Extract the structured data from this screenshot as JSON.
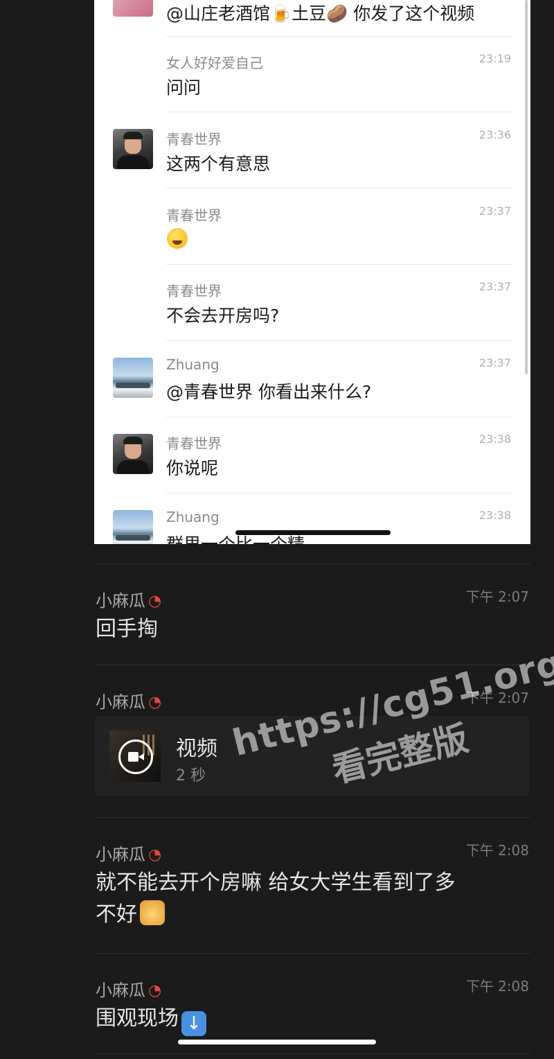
{
  "embedded_chat": {
    "messages": [
      {
        "sender": "",
        "time": "",
        "text": "@山庄老酒馆🍺土豆🥔 你发了这个视频"
      },
      {
        "sender": "女人好好爱自己",
        "time": "23:19",
        "text": "问问"
      },
      {
        "sender": "青春世界",
        "time": "23:36",
        "text": "这两个有意思"
      },
      {
        "sender": "青春世界",
        "time": "23:37",
        "text": ""
      },
      {
        "sender": "青春世界",
        "time": "23:37",
        "text": "不会去开房吗?"
      },
      {
        "sender": "Zhuang",
        "time": "23:37",
        "text": "@青春世界 你看出来什么?"
      },
      {
        "sender": "青春世界",
        "time": "23:38",
        "text": "你说呢"
      },
      {
        "sender": "Zhuang",
        "time": "23:38",
        "text": "群里一个比一个精"
      }
    ]
  },
  "chat": {
    "messages": [
      {
        "sender": "小麻瓜",
        "time": "下午 2:07",
        "text": "回手掏"
      },
      {
        "sender": "小麻瓜",
        "time": "下午 2:07",
        "video": {
          "label": "视频",
          "duration": "2 秒"
        }
      },
      {
        "sender": "小麻瓜",
        "time": "下午 2:08",
        "text_line1": "就不能去开个房嘛 给女大学生看到了多",
        "text_line2": "不好"
      },
      {
        "sender": "小麻瓜",
        "time": "下午 2:08",
        "text": "围观现场"
      }
    ]
  },
  "watermark": {
    "url": "https://cg51.org",
    "subtitle": "看完整版"
  },
  "icons": {
    "sender_emoji": "watermelon-icon",
    "crying_laughing": "laughing-crying-emoji-icon",
    "cat_emoji": "cat-face-emoji-icon",
    "down_arrow": "down-arrow-emoji-icon",
    "video": "video-camera-icon"
  },
  "colors": {
    "background": "#1b1b1b",
    "embedded_background": "#ffffff",
    "watermelon": "#e84545"
  }
}
